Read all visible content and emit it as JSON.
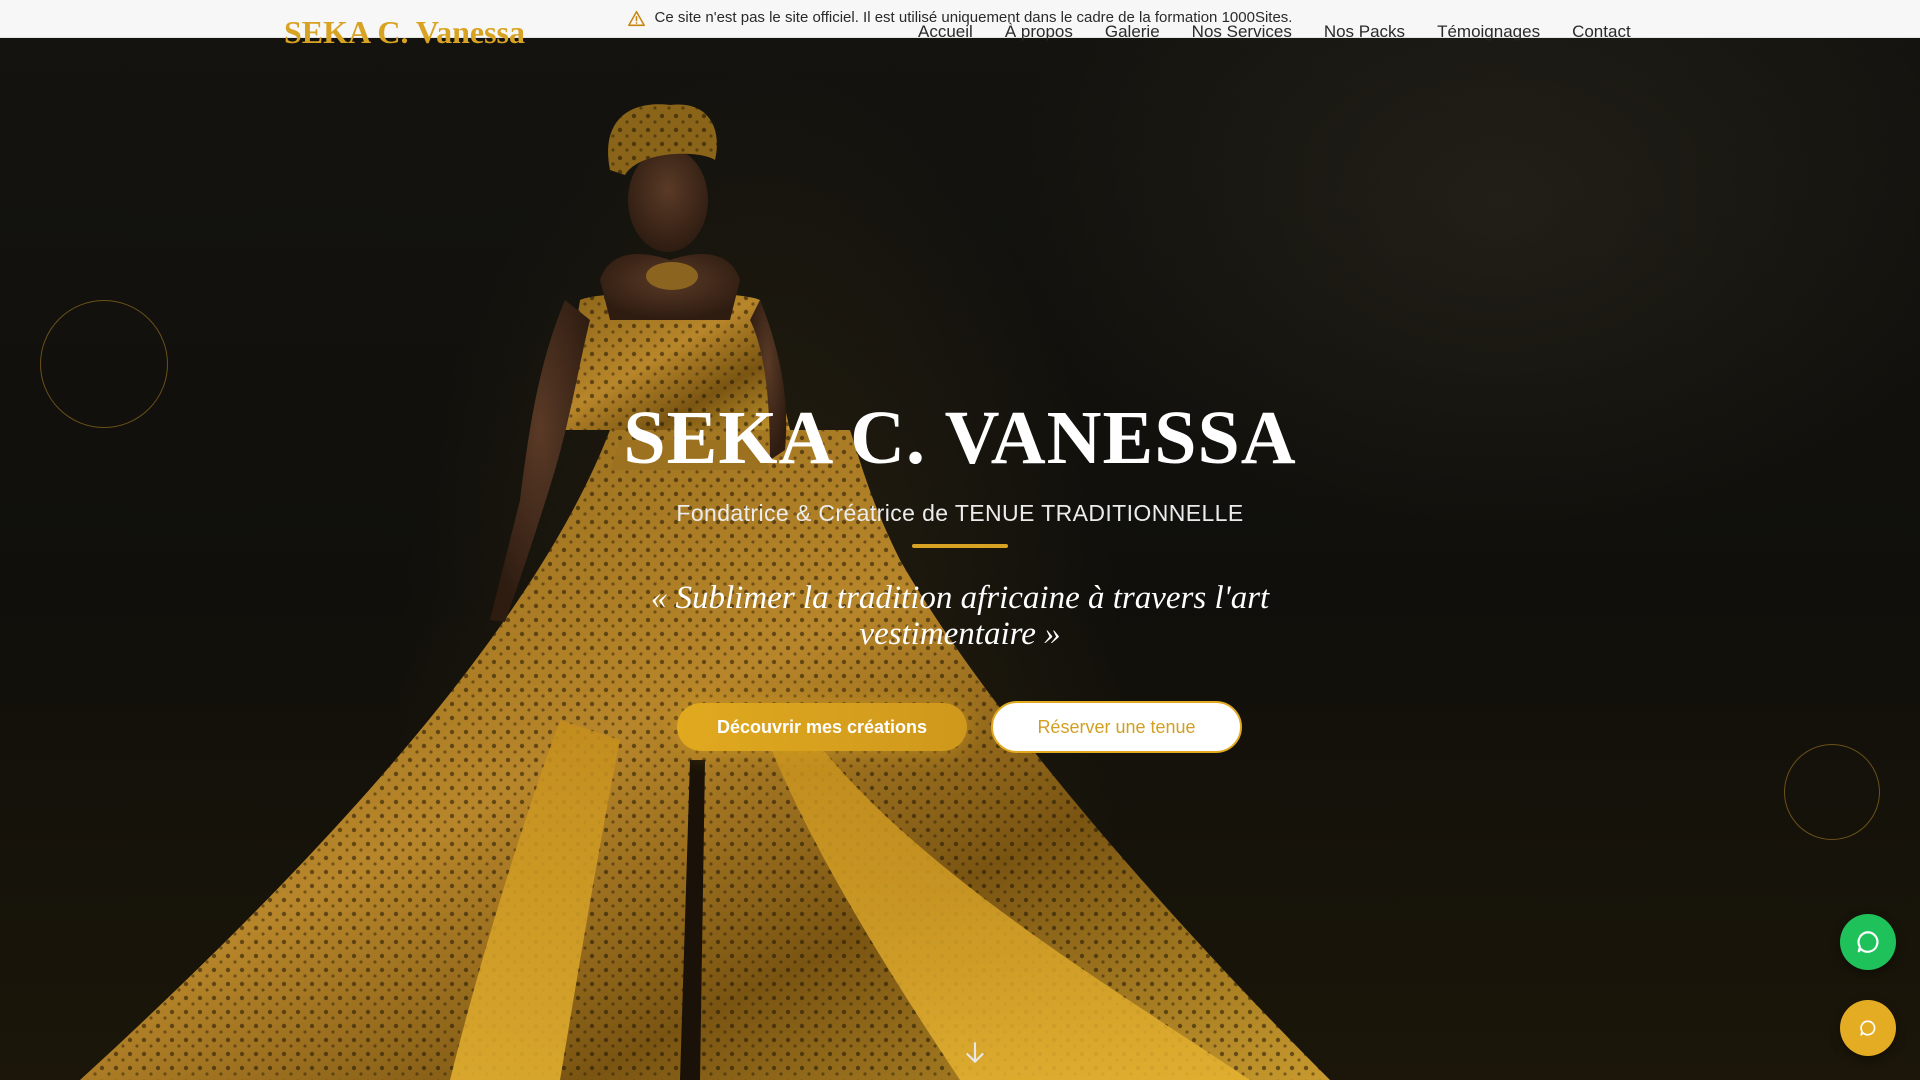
{
  "notice": {
    "icon": "warning-triangle-icon",
    "text": "Ce site n'est pas le site officiel. Il est utilisé uniquement dans le cadre de la formation 1000Sites."
  },
  "header": {
    "brand": "SEKA C. Vanessa",
    "nav": [
      "Accueil",
      "À propos",
      "Galerie",
      "Nos Services",
      "Nos Packs",
      "Témoignages",
      "Contact"
    ]
  },
  "hero": {
    "title": "SEKA C. VANESSA",
    "subtitle": "Fondatrice & Créatrice de TENUE TRADITIONNELLE",
    "quote": "« Sublimer la tradition africaine à travers l'art vestimentaire »",
    "primary_button": "Découvrir mes créations",
    "secondary_button": "Réserver une tenue",
    "scroll_icon": "arrow-down-icon"
  },
  "floating": {
    "whatsapp_icon": "whatsapp-icon",
    "chat_icon": "chat-bubble-icon"
  },
  "colors": {
    "accent": "#d8a322",
    "whatsapp": "#1fc25a",
    "background": "#0d0c09"
  }
}
